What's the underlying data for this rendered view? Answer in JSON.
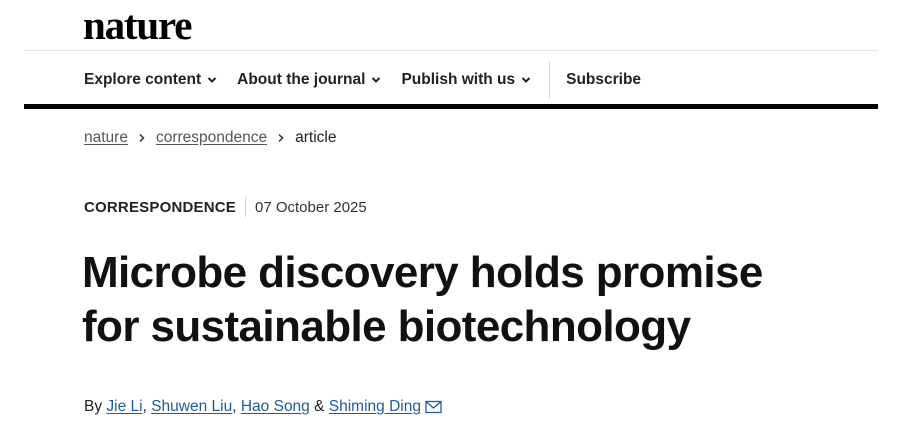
{
  "header": {
    "logo": "nature"
  },
  "nav": {
    "items": [
      {
        "label": "Explore content"
      },
      {
        "label": "About the journal"
      },
      {
        "label": "Publish with us"
      }
    ],
    "subscribe": "Subscribe"
  },
  "breadcrumb": {
    "items": [
      "nature",
      "correspondence",
      "article"
    ]
  },
  "article": {
    "type": "CORRESPONDENCE",
    "date": "07 October 2025",
    "title_line1": "Microbe discovery holds promise",
    "title_line2": "for sustainable biotechnology",
    "by": "By",
    "authors": [
      "Jie Li",
      "Shuwen Liu",
      "Hao Song",
      "Shiming Ding"
    ],
    "comma": ",",
    "ampersand": "&"
  },
  "icons": {
    "nav_chevrons": "chevron-down-icon",
    "breadcrumb_separators": "chevron-right-icon",
    "contact": "mail-icon"
  },
  "colors": {
    "link": "#1f5c99",
    "bar": "#000000"
  }
}
